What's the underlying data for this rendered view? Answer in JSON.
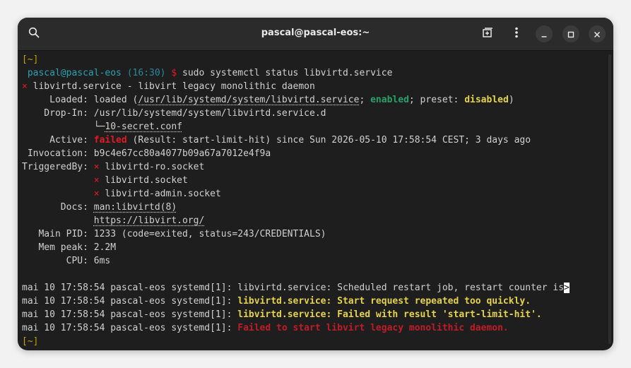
{
  "window": {
    "title": "pascal@pascal-eos:~"
  },
  "icons": {
    "search": "search-icon",
    "new_tab": "new-tab-icon",
    "menu": "kebab-menu-icon",
    "minimize": "minimize-icon",
    "maximize": "maximize-icon",
    "close": "close-icon"
  },
  "colors": {
    "prompt_bracket": "#c4a000",
    "user_host": "#2aa1b3",
    "failed": "#e01b24",
    "enabled": "#26a269",
    "warning": "#e5d34c",
    "bg": "#1e1e1e"
  },
  "terminal": {
    "prompt_dir": "[~]",
    "prompt_user": "pascal@pascal-eos",
    "prompt_time": "(16:30)",
    "prompt_symbol": "$",
    "command": "sudo systemctl status libvirtd.service",
    "fail_mark": "×",
    "service_header": "libvirtd.service - libvirt legacy monolithic daemon",
    "loaded_label": "     Loaded:",
    "loaded_pre": "loaded (",
    "loaded_path": "/usr/lib/systemd/system/libvirtd.service",
    "loaded_sep1": ";",
    "loaded_enabled": "enabled",
    "loaded_preset": "; preset:",
    "loaded_disabled": "disabled",
    "loaded_post": ")",
    "dropin_label": "    Drop-In:",
    "dropin_path": "/usr/lib/systemd/system/libvirtd.service.d",
    "dropin_tree": "└─",
    "dropin_file": "10-secret.conf",
    "active_label": "     Active:",
    "active_state": "failed",
    "active_rest": "(Result: start-limit-hit) since Sun 2026-05-10 17:58:54 CEST; 3 days ago",
    "invocation_label": " Invocation:",
    "invocation_value": "b9c4e67cc80a4077b09a67a7012e4f9a",
    "triggered_label": "TriggeredBy:",
    "triggers": [
      "libvirtd-ro.socket",
      "libvirtd.socket",
      "libvirtd-admin.socket"
    ],
    "docs_label": "       Docs:",
    "docs": [
      "man:libvirtd(8)",
      "https://libvirt.org/"
    ],
    "mainpid_label": "   Main PID:",
    "mainpid_value": "1233 (code=exited, status=243/CREDENTIALS)",
    "mempeak_label": "   Mem peak:",
    "mempeak_value": "2.2M",
    "cpu_label": "        CPU:",
    "cpu_value": "6ms",
    "log_prefix": "mai 10 17:58:54 pascal-eos systemd[1]:",
    "log1": "libvirtd.service: Scheduled restart job, restart counter is",
    "log1_more": ">",
    "log2": "libvirtd.service: Start request repeated too quickly.",
    "log3": "libvirtd.service: Failed with result 'start-limit-hit'.",
    "log4": "Failed to start libvirt legacy monolithic daemon."
  }
}
